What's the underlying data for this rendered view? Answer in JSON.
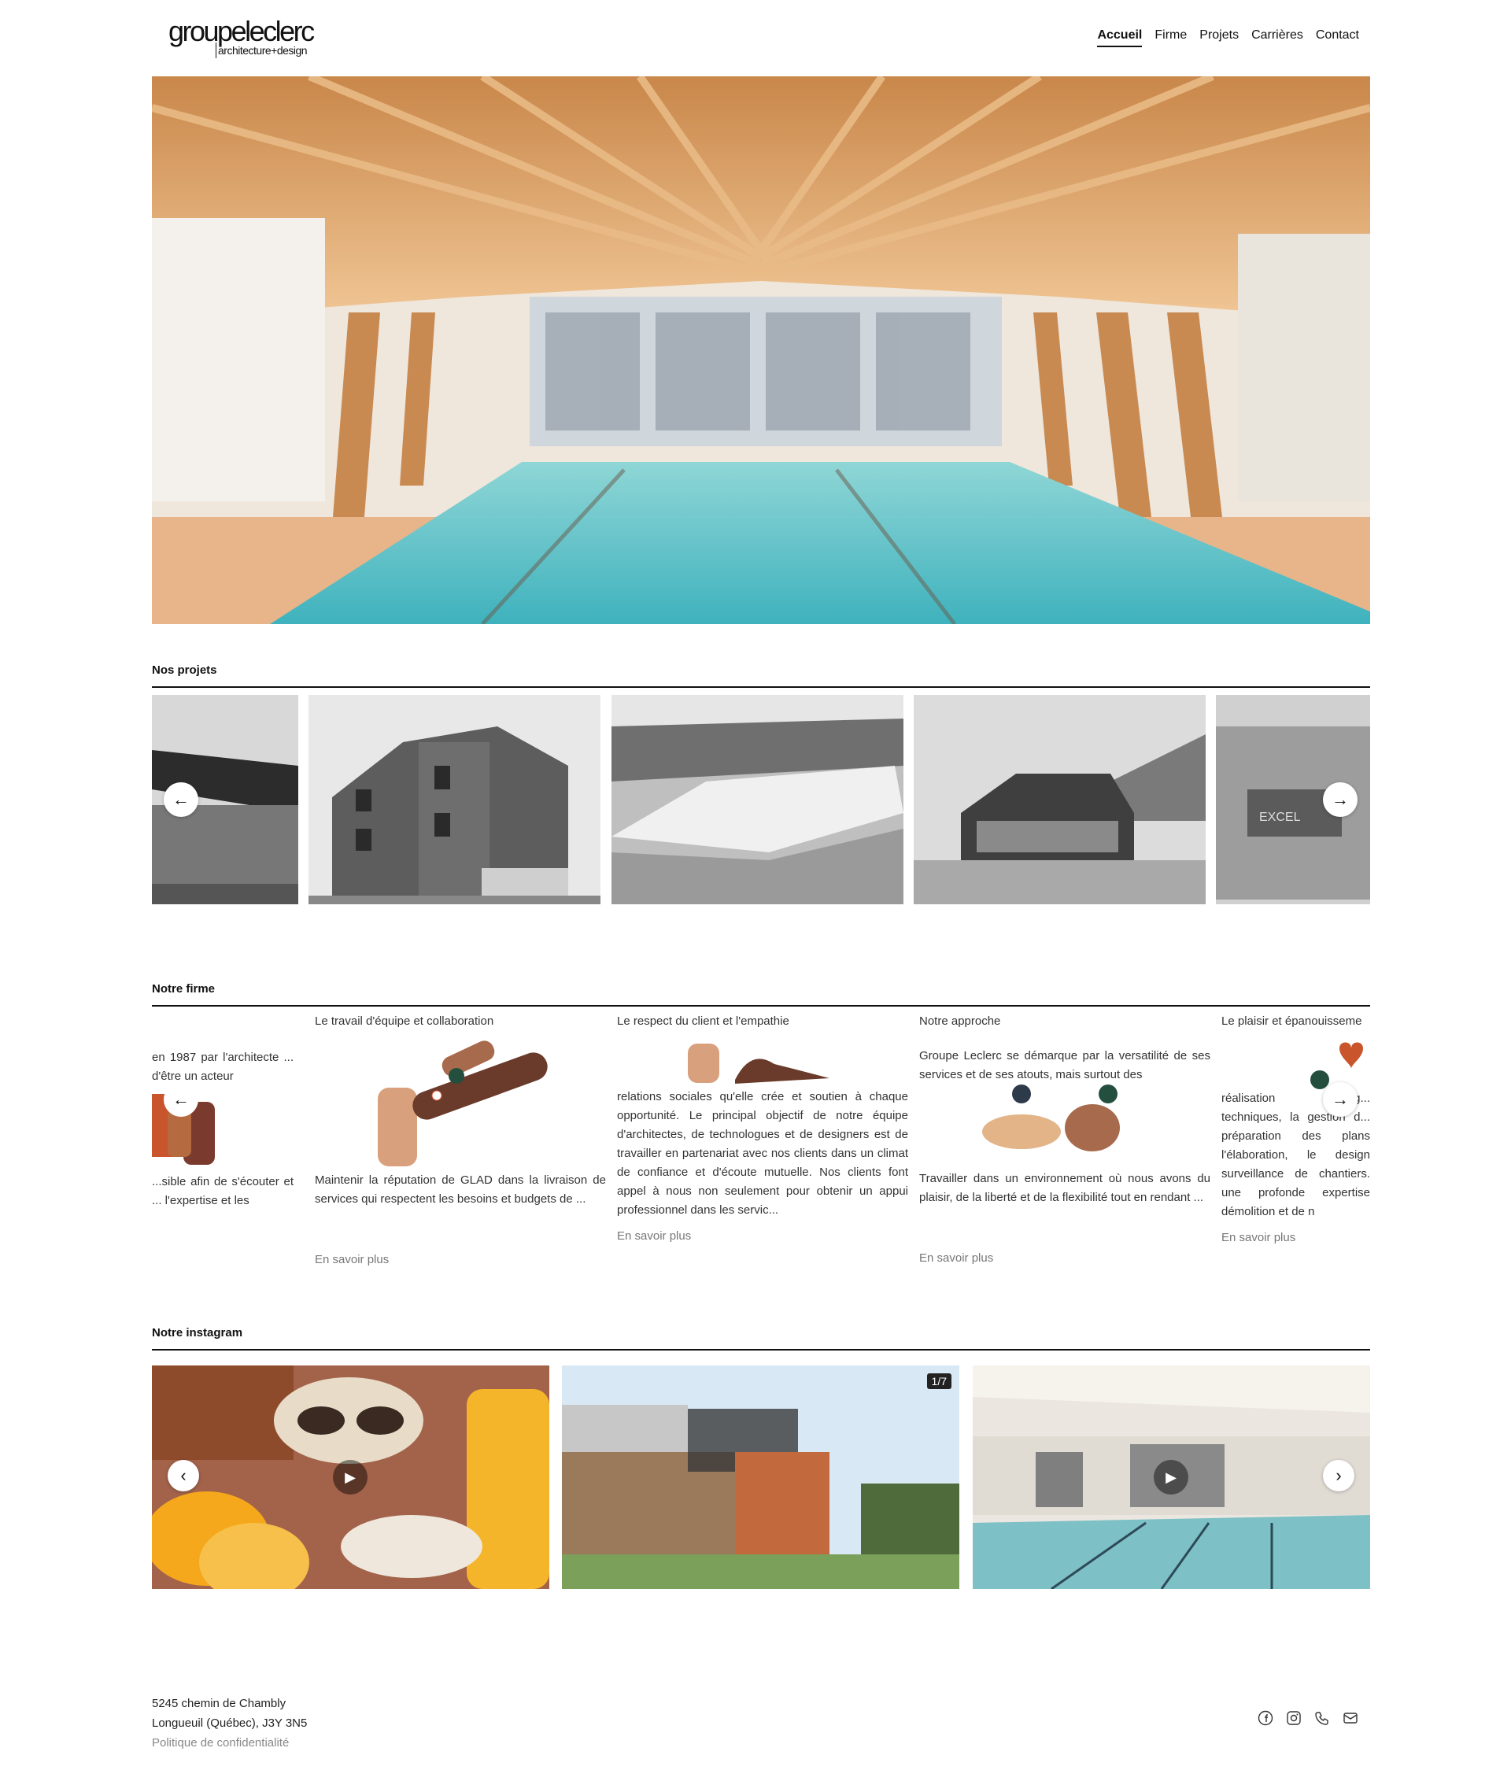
{
  "brand": {
    "name": "groupeleclerc",
    "tagline": "architecture+design"
  },
  "nav": {
    "items": [
      {
        "label": "Accueil",
        "active": true
      },
      {
        "label": "Firme",
        "active": false
      },
      {
        "label": "Projets",
        "active": false
      },
      {
        "label": "Carrières",
        "active": false
      },
      {
        "label": "Contact",
        "active": false
      }
    ]
  },
  "projects": {
    "title": "Nos projets",
    "prev_icon": "arrow-left-icon",
    "next_icon": "arrow-right-icon"
  },
  "firm": {
    "title": "Notre firme",
    "cards": [
      {
        "title": "",
        "intro": "en 1987 par l'architecte ... d'être un acteur",
        "text": "...sible afin de s'écouter et ... l'expertise et les",
        "more": ""
      },
      {
        "title": "Le travail d'équipe et collaboration",
        "intro": "",
        "text": "Maintenir la réputation de GLAD dans la livraison de services qui respectent les besoins et budgets de ...",
        "more": "En savoir plus"
      },
      {
        "title": "Le respect du client et l'empathie",
        "intro": "",
        "text": "relations sociales qu'elle crée et soutien à chaque opportunité. Le principal objectif de notre équipe d'architectes, de technologues et de designers est de travailler en partenariat avec nos clients dans un climat de confiance et d'écoute mutuelle. Nos clients font appel à nous non seulement pour obtenir un appui professionnel dans les servic...",
        "more": "En savoir plus"
      },
      {
        "title": "Notre approche",
        "intro": "Groupe Leclerc se démarque par la versatilité de ses services et de ses atouts, mais surtout des",
        "text": "Travailler dans un environnement où nous avons du plaisir, de la liberté et de la flexibilité tout en rendant ...",
        "more": "En savoir plus"
      },
      {
        "title": "Le plaisir et épanouisseme",
        "intro": "",
        "text": "réalisation prog... techniques, la gestion d... préparation des plans l'élaboration, le design surveillance de chantiers. une profonde expertise démolition et de n",
        "more": "En savoir plus"
      }
    ]
  },
  "instagram": {
    "title": "Notre instagram",
    "badge": "1/7"
  },
  "footer": {
    "address_line1": "5245 chemin de Chambly",
    "address_line2": "Longueuil (Québec), J3Y 3N5",
    "privacy": "Politique de confidentialité",
    "social_icons": [
      "facebook-icon",
      "instagram-icon",
      "phone-icon",
      "mail-icon"
    ]
  },
  "colors": {
    "text": "#111111",
    "muted": "#777777",
    "rule": "#111111",
    "wood": "#d9a56f",
    "pool": "#6cc6c9"
  }
}
